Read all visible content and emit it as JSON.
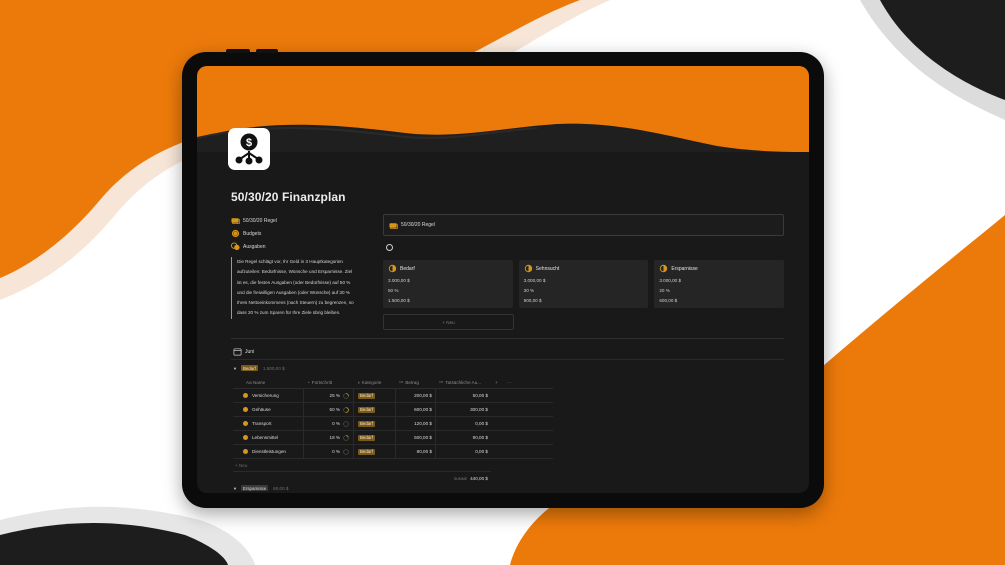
{
  "colors": {
    "accent": "#ec7a0a",
    "gold": "#d5961c",
    "screen_bg": "#191919"
  },
  "page": {
    "title": "50/30/20 Finanzplan"
  },
  "sidebar": {
    "items": [
      {
        "label": "50/30/20 Regel",
        "icon": "money-stack-icon"
      },
      {
        "label": "Budgets",
        "icon": "coin-icon"
      },
      {
        "label": "Ausgaben",
        "icon": "coins-icon"
      }
    ],
    "quote": "Die Regel schlägt vor, Ihr Geld in 3 Hauptkategorien aufzuteilen: Bedürfnisse, Wünsche und Ersparnisse. Ziel ist es, die festen Ausgaben (oder Bedürfnisse) auf 50 % und die freiwilligen Ausgaben (oder Wünsche) auf 30 % Ihres Nettoeinkommens (nach Steuern) zu begrenzen, so dass 20 % zum Sparen für Ihre Ziele übrig bleiben."
  },
  "rule": {
    "title": "50/30/20 Regel"
  },
  "cards": [
    {
      "title": "Bedarf",
      "amount": "3.000,00 $",
      "percent": "50 %",
      "value": "1.500,00 $"
    },
    {
      "title": "Sehnsucht",
      "amount": "3.000,00 $",
      "percent": "30 %",
      "value": "900,00 $"
    },
    {
      "title": "Ersparnisse",
      "amount": "3.000,00 $",
      "percent": "20 %",
      "value": "600,00 $"
    }
  ],
  "new_label": "+ Neu",
  "month": "Juni",
  "groups": [
    {
      "tag": "Bedarf",
      "total": "1.500,00 $"
    },
    {
      "tag": "Ersparnisse",
      "total": "60,00 $"
    }
  ],
  "table": {
    "headers": {
      "name": "Aa Name",
      "progress": "Fortschritt",
      "category": "Kategorie",
      "amount": "Betrag",
      "actual": "Tatsächliche Au...",
      "plus": "+",
      "more": "···"
    },
    "rows": [
      {
        "name": "Versicherung",
        "progress": "25 %",
        "progress_value": 0.25,
        "category": "Bedarf",
        "amount": "200,00 $",
        "actual": "50,00 $"
      },
      {
        "name": "Gehäuse",
        "progress": "50 %",
        "progress_value": 0.5,
        "category": "Bedarf",
        "amount": "600,00 $",
        "actual": "300,00 $"
      },
      {
        "name": "Transport",
        "progress": "0 %",
        "progress_value": 0,
        "category": "Bedarf",
        "amount": "120,00 $",
        "actual": "0,00 $"
      },
      {
        "name": "Lebensmittel",
        "progress": "18 %",
        "progress_value": 0.18,
        "category": "Bedarf",
        "amount": "500,00 $",
        "actual": "90,00 $"
      },
      {
        "name": "Dienstleistungen",
        "progress": "0 %",
        "progress_value": 0,
        "category": "Bedarf",
        "amount": "80,00 $",
        "actual": "0,00 $"
      }
    ],
    "new_row": "+ Neu",
    "sum_label": "SUMME",
    "sum_value": "440,00 $"
  }
}
